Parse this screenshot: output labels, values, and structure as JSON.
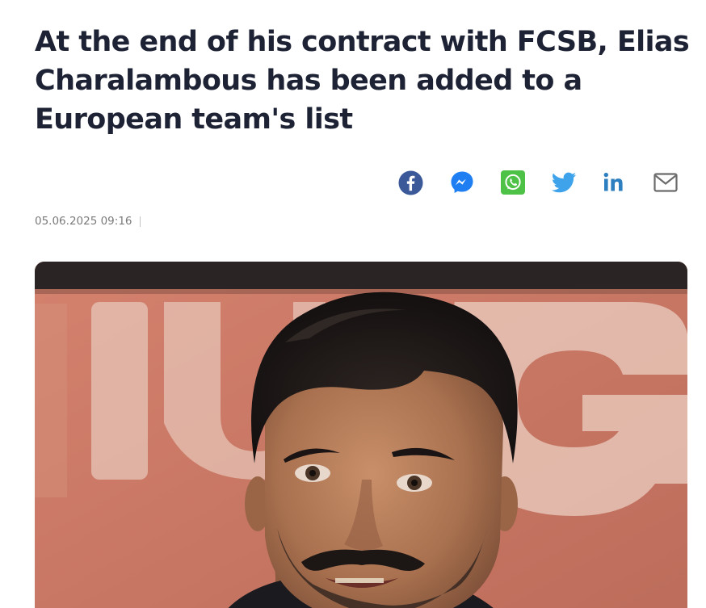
{
  "article": {
    "title": "At the end of his contract with FCSB, Elias Charalambous has been added to a European team's list",
    "date": "05.06.2025 09:16"
  },
  "share": {
    "icons": [
      "facebook-icon",
      "messenger-icon",
      "whatsapp-icon",
      "twitter-icon",
      "linkedin-icon",
      "email-icon"
    ]
  },
  "colors": {
    "title": "#1e2235",
    "facebook": "#3b5998",
    "messenger": "#1f7ff2",
    "whatsapp": "#4dc247",
    "twitter": "#3ea3ea",
    "linkedin": "#2d7fc0",
    "email": "#6b6b6b",
    "photo_background": "#c97965"
  }
}
